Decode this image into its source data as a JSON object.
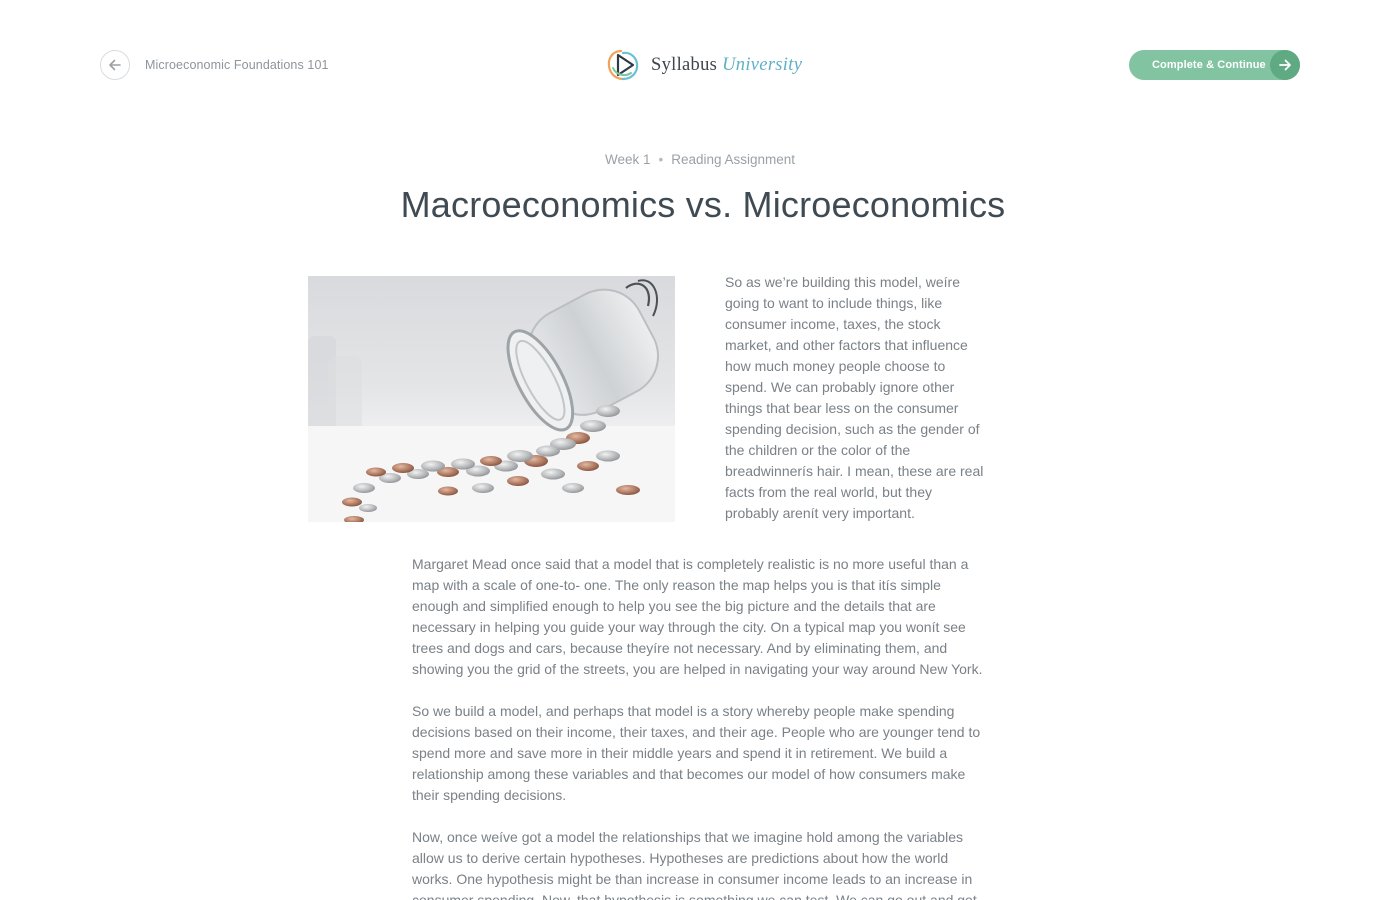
{
  "header": {
    "course_name": "Microeconomic Foundations 101",
    "brand_main": "Syllabus",
    "brand_accent": "University",
    "cta_label": "Complete & Continue"
  },
  "icons": {
    "back": "arrow-left-icon",
    "logo": "syllabus-logo-icon",
    "forward": "arrow-right-icon"
  },
  "lesson": {
    "week": "Week 1",
    "type": "Reading Assignment",
    "title": "Macroeconomics vs. Microeconomics",
    "image_alt": "Coins spilling out of a glass jar"
  },
  "paragraphs": [
    "So as we’re building this model, weíre going to want to include things, like consumer income, taxes, the stock market, and other factors that influence how much money people choose to spend. We can probably ignore other things that bear less on the consumer spending decision, such as the gender of the children or the color of the breadwinnerís hair. I mean, these are real facts from the real world, but they probably arenít very important.",
    "Margaret Mead once said that a model that is completely realistic is no more useful than a map with a scale of one-to- one. The only reason the map helps you is that itís simple enough and simplified enough to help you see the big picture and the details that are necessary in helping you guide your way through the city. On a typical map you wonít see trees and dogs and cars, because theyíre not necessary. And by eliminating them, and showing you the grid of the streets, you are helped in navigating your way around New York.",
    "So we build a model, and perhaps that model is a story whereby people make spending decisions based on their income, their taxes, and their age. People who are younger tend to spend more and save more in their middle years and spend it in retirement. We build a relationship among these variables and that becomes our model of how consumers make their spending decisions.",
    "Now, once weíve got a model the relationships that we imagine hold among the variables allow us to derive certain hypotheses. Hypotheses are predictions about how the world works. One hypothesis might be than increase in consumer income leads to an increase in consumer spending. Now, that hypothesis is something we can test. We can go out and get"
  ],
  "colors": {
    "accent_green": "#82c4a2",
    "accent_green_dark": "#5fa983",
    "brand_blue": "#5fb0c6",
    "title": "#3f4a53",
    "body_text": "#7a8187"
  }
}
